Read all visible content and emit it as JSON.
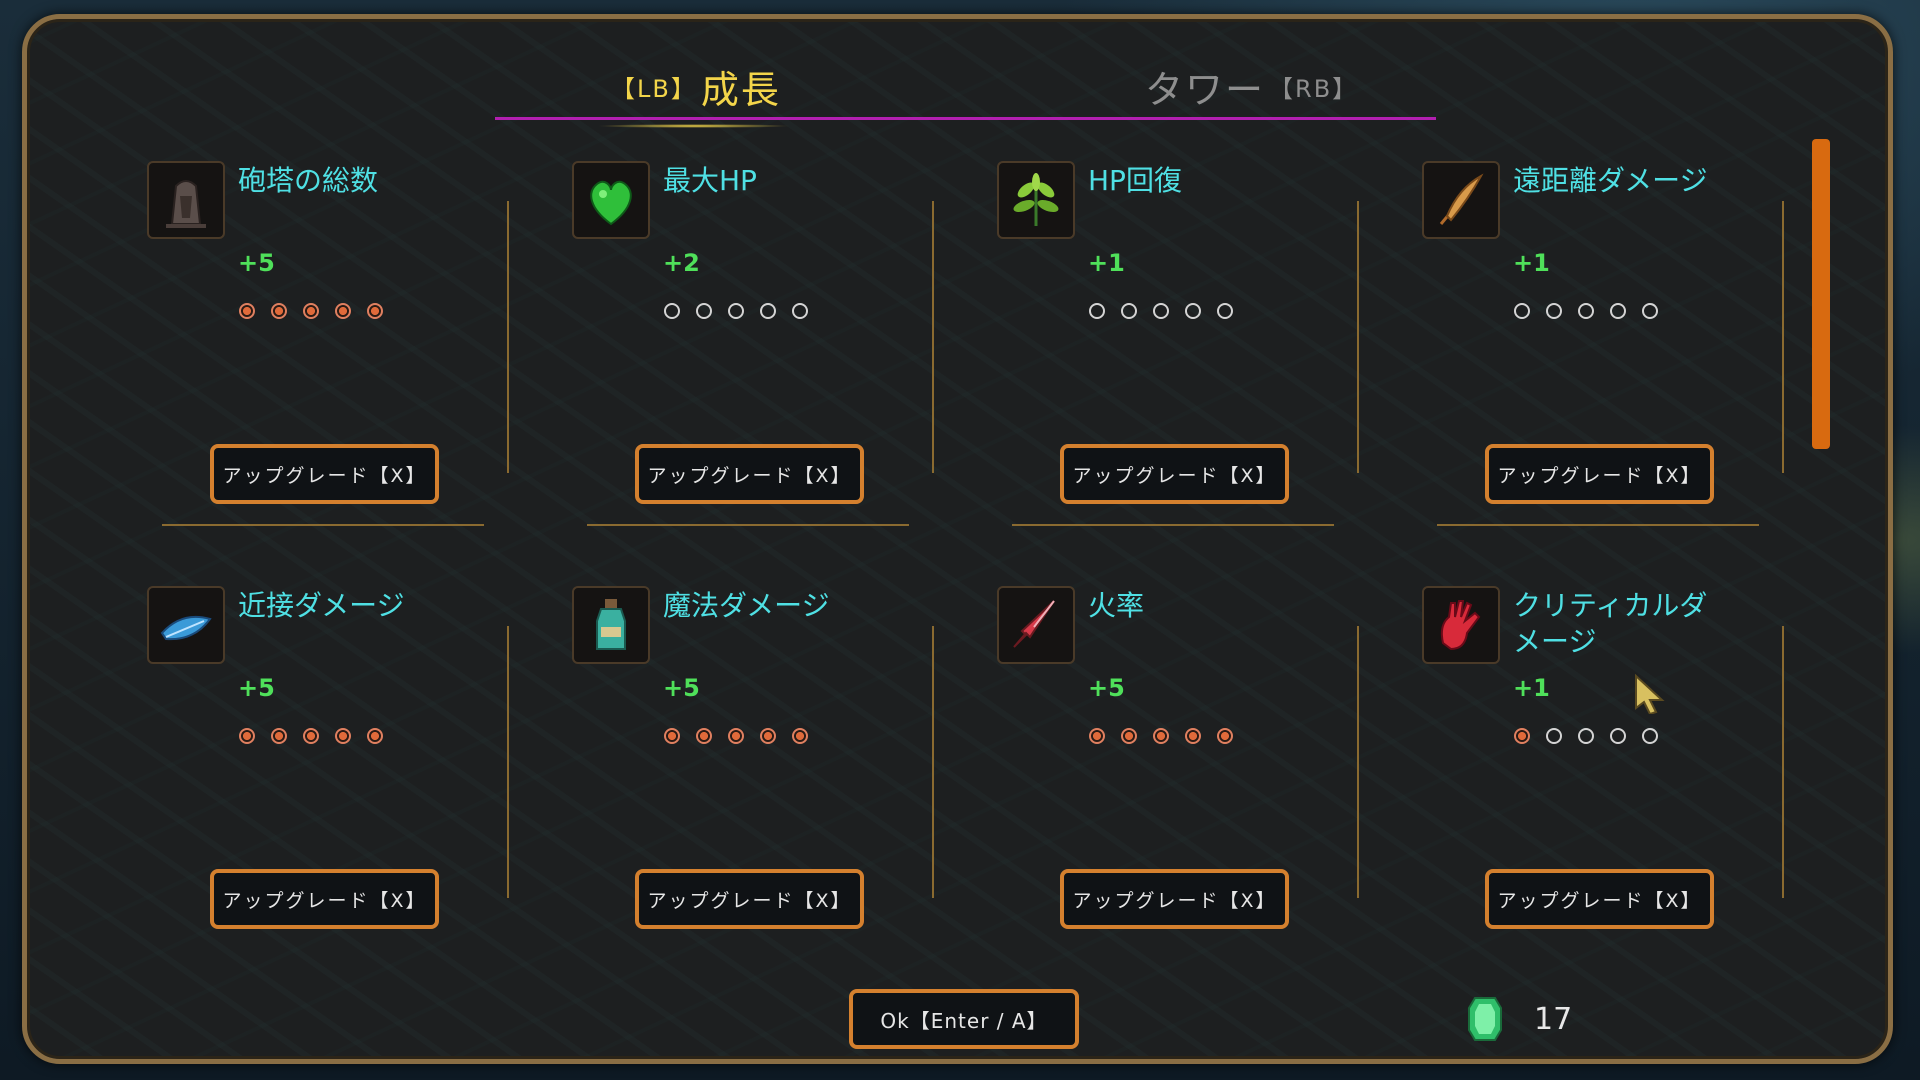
{
  "tabs": {
    "growth": {
      "key": "【LB】",
      "label": "成長",
      "active": true
    },
    "tower": {
      "label": "タワー",
      "key": "【RB】",
      "active": false
    }
  },
  "cards": [
    {
      "icon": "turret-icon",
      "title": "砲塔の総数",
      "value": "+5",
      "level": 5,
      "max": 5,
      "button": "アップグレード【X】"
    },
    {
      "icon": "green-heart-icon",
      "title": "最大HP",
      "value": "+2",
      "level": 0,
      "max": 5,
      "button": "アップグレード【X】"
    },
    {
      "icon": "herb-icon",
      "title": "HP回復",
      "value": "+1",
      "level": 0,
      "max": 5,
      "button": "アップグレード【X】"
    },
    {
      "icon": "feather-arrow-icon",
      "title": "遠距離ダメージ",
      "value": "+1",
      "level": 0,
      "max": 5,
      "button": "アップグレード【X】"
    },
    {
      "icon": "blue-feather-icon",
      "title": "近接ダメージ",
      "value": "+5",
      "level": 5,
      "max": 5,
      "button": "アップグレード【X】"
    },
    {
      "icon": "potion-bottle-icon",
      "title": "魔法ダメージ",
      "value": "+5",
      "level": 5,
      "max": 5,
      "button": "アップグレード【X】"
    },
    {
      "icon": "dagger-icon",
      "title": "火率",
      "value": "+5",
      "level": 5,
      "max": 5,
      "button": "アップグレード【X】"
    },
    {
      "icon": "red-hand-icon",
      "title": "クリティカルダメージ",
      "value": "+1",
      "level": 1,
      "max": 5,
      "button": "アップグレード【X】"
    }
  ],
  "footer": {
    "ok_label": "Ok【Enter / A】",
    "gem_icon": "green-gem-icon",
    "gem_count": "17"
  },
  "colors": {
    "accent_tab": "#f3d54a",
    "tab_underline": "#b21fb0",
    "title": "#4fe0e4",
    "value": "#4fe05a",
    "button_border": "#d4802e",
    "scrollbar": "#d86a10"
  }
}
